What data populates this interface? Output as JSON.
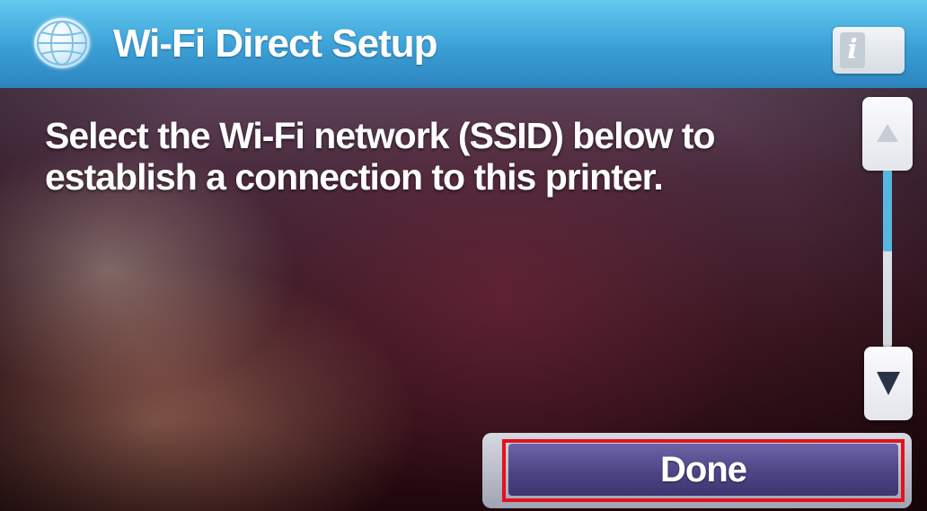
{
  "title_bar": {
    "title": "Wi-Fi Direct Setup",
    "icon": "globe-icon",
    "info_button": {
      "icon": "info-icon",
      "glyph": "i"
    },
    "accent_color": "#3a9fd6"
  },
  "main": {
    "message": "Select the Wi-Fi network (SSID) below to establish a connection to this printer."
  },
  "scrollbar": {
    "up_icon": "chevron-up-icon",
    "down_icon": "chevron-down-icon",
    "thumb_color": "#58b7e0"
  },
  "actions": {
    "done_label": "Done",
    "highlight_color": "#e3121d"
  }
}
